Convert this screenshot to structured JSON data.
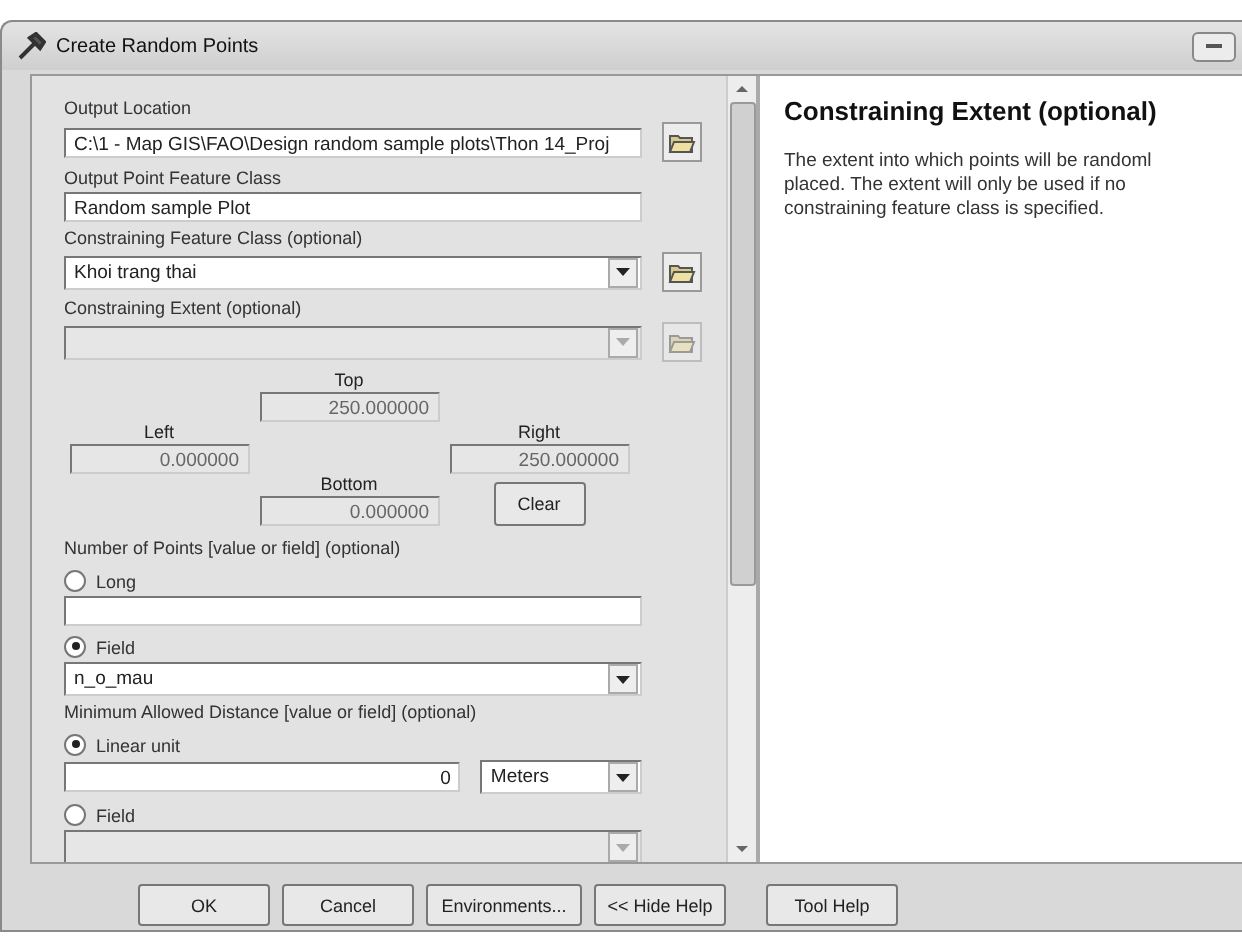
{
  "window": {
    "title": "Create Random Points"
  },
  "form": {
    "output_location": {
      "label": "Output Location",
      "value": "C:\\1 - Map GIS\\FAO\\Design random sample plots\\Thon 14_Proj"
    },
    "output_class": {
      "label": "Output Point Feature Class",
      "value": "Random sample Plot"
    },
    "constraining_class": {
      "label": "Constraining Feature Class (optional)",
      "value": "Khoi trang thai"
    },
    "constraining_extent": {
      "label": "Constraining Extent (optional)",
      "disabled": true,
      "top": {
        "label": "Top",
        "value": "250.000000"
      },
      "left": {
        "label": "Left",
        "value": "0.000000"
      },
      "right": {
        "label": "Right",
        "value": "250.000000"
      },
      "bottom": {
        "label": "Bottom",
        "value": "0.000000"
      },
      "clear": "Clear"
    },
    "number_of_points": {
      "label": "Number of Points [value or field] (optional)",
      "options": [
        {
          "label": "Long",
          "selected": false
        },
        {
          "label": "Field",
          "selected": true
        }
      ],
      "field_value": "n_o_mau"
    },
    "min_distance": {
      "label": "Minimum Allowed Distance [value or field] (optional)",
      "options": [
        {
          "label": "Linear unit",
          "selected": true
        },
        {
          "label": "Field",
          "selected": false
        }
      ],
      "value": "0",
      "unit": "Meters"
    }
  },
  "help": {
    "title": "Constraining Extent (optional)",
    "lines": [
      "The extent into which points will be randoml",
      "placed. The extent will only be used if no",
      "constraining feature class is specified."
    ]
  },
  "buttons": [
    "OK",
    "Cancel",
    "Environments...",
    "<< Hide Help",
    "Tool Help"
  ]
}
